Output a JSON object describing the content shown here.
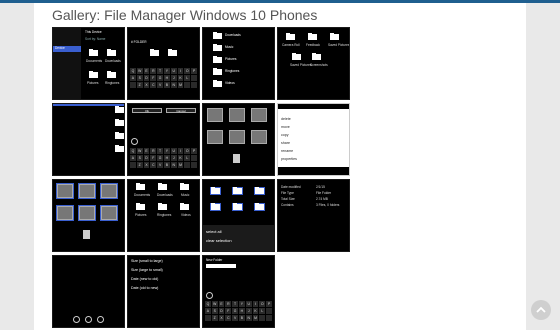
{
  "page": {
    "title": "Gallery: File Manager Windows 10 Phones"
  },
  "shots": {
    "s1": {
      "header": "This Device",
      "sort": "Sort by: Name",
      "side": "Device",
      "f1": "Documents",
      "f2": "Downloads",
      "f3": "Pictures",
      "f4": "Ringtones"
    },
    "s2": {
      "path": "# FOLDER"
    },
    "s3": {
      "f1": "Downloads",
      "f2": "Music",
      "f3": "Pictures",
      "f4": "Ringtones",
      "f5": "Videos"
    },
    "s4": {
      "f1": "Camera Roll",
      "f2": "Feedback",
      "f3": "Saved Pictures",
      "f4": "Saved Pictures",
      "f5": "Screenshots"
    },
    "s6": {
      "ok": "Ok",
      "cancel": "Cancel"
    },
    "s8": {
      "items": [
        "delete",
        "move",
        "copy",
        "share",
        "rename",
        "properties"
      ]
    },
    "s11": {
      "selectAll": "select all",
      "clearSelection": "clear selection"
    },
    "s12": {
      "rows": [
        [
          "Date modified",
          "2/1/15"
        ],
        [
          "File Type",
          "File Folder"
        ],
        [
          "Total Size",
          "2.74 MB"
        ],
        [
          "Contains",
          "3 Files, 0 folders"
        ]
      ]
    },
    "s14": {
      "items": [
        "Size (small to large)",
        "Size (large to small)",
        "Date (new to old)",
        "Date (old to new)"
      ]
    },
    "s15": {
      "header": "New Folder"
    }
  },
  "keyboard": {
    "row1": [
      "Q",
      "W",
      "E",
      "R",
      "T",
      "Y",
      "U",
      "I",
      "O",
      "P"
    ],
    "row2": [
      "A",
      "S",
      "D",
      "F",
      "G",
      "H",
      "J",
      "K",
      "L",
      ""
    ],
    "row3": [
      "",
      "Z",
      "X",
      "C",
      "V",
      "B",
      "N",
      "M",
      "",
      ""
    ]
  },
  "colors": {
    "accent": "#3a5fd0",
    "topbar": "#1f5f8f"
  },
  "icons": {
    "scrollTop": "chevron-up-icon"
  }
}
